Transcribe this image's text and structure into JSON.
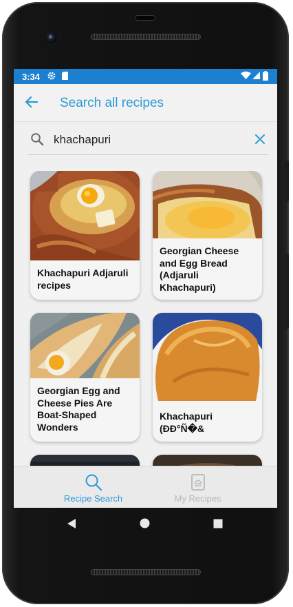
{
  "status_bar": {
    "time": "3:34",
    "background_color": "#1d7fcf"
  },
  "app_bar": {
    "title": "Search all recipes",
    "back_icon": "arrow-left-icon",
    "accent_color": "#2a9ad6"
  },
  "search": {
    "value": "khachapuri",
    "placeholder": "",
    "search_icon": "search-icon",
    "clear_icon": "close-icon"
  },
  "results": [
    {
      "title": "Khachapuri Adjaruli recipes",
      "image": "khachapuri-boat-with-egg-photo"
    },
    {
      "title": "Georgian Cheese and Egg Bread (Adjaruli Khachapuri)",
      "image": "cheese-bread-closeup-photo"
    },
    {
      "title": "Georgian Egg and Cheese Pies Are Boat-Shaped Wonders",
      "image": "egg-cheese-pies-photo"
    },
    {
      "title": "Khachapuri (ÐÐ°Ñ�&",
      "image": "baked-khachapuri-plate-photo"
    }
  ],
  "bottom_nav": {
    "items": [
      {
        "label": "Recipe Search",
        "icon": "search-icon",
        "active": true,
        "color": "#2a9ad6"
      },
      {
        "label": "My Recipes",
        "icon": "recipe-book-icon",
        "active": false,
        "color": "#b8b8b8"
      }
    ]
  },
  "system_nav": {
    "back": "back-triangle-icon",
    "home": "home-circle-icon",
    "recents": "recents-square-icon"
  }
}
